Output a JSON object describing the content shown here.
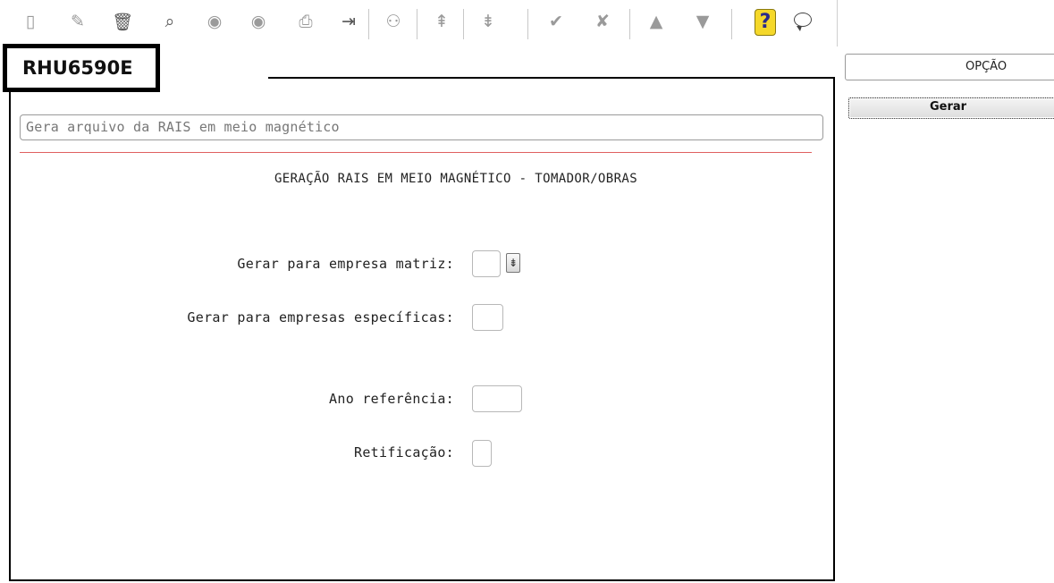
{
  "toolbar": {
    "buttons": [
      {
        "icon": "new-document-icon",
        "glyph": "▯"
      },
      {
        "icon": "edit-icon",
        "glyph": "✎"
      },
      {
        "icon": "trash-icon",
        "glyph": "🗑"
      },
      {
        "icon": "search-icon",
        "glyph": "⌕"
      },
      {
        "icon": "previous-icon",
        "glyph": "◉"
      },
      {
        "icon": "next-icon",
        "glyph": "◉"
      },
      {
        "icon": "print-icon",
        "glyph": "⎙"
      },
      {
        "icon": "exit-icon",
        "glyph": "⇥"
      },
      {
        "icon": "binoculars-icon",
        "glyph": "⚇"
      },
      {
        "icon": "first-record-icon",
        "glyph": "⇞"
      },
      {
        "icon": "last-record-icon",
        "glyph": "⇟"
      },
      {
        "icon": "confirm-icon",
        "glyph": "✔"
      },
      {
        "icon": "cancel-icon",
        "glyph": "✘"
      },
      {
        "icon": "up-icon",
        "glyph": "▲"
      },
      {
        "icon": "filter-icon",
        "glyph": "▼"
      }
    ],
    "help_glyph": "?"
  },
  "form": {
    "code": "RHU6590E",
    "description": "Gera arquivo da RAIS em meio magnético",
    "section_title": "GERAÇÃO RAIS EM MEIO MAGNÉTICO - TOMADOR/OBRAS",
    "fields": {
      "empresa_matriz_label": "Gerar para empresa matriz:",
      "empresa_matriz_value": "",
      "empresas_especificas_label": "Gerar para empresas específicas:",
      "empresas_especificas_value": "",
      "ano_referencia_label": "Ano referência:",
      "ano_referencia_value": "",
      "retificacao_label": "Retificação:",
      "retificacao_value": ""
    },
    "dropdown_glyph": "⇟"
  },
  "side_panel": {
    "header": "OPÇÃO",
    "options": [
      "Gerar"
    ]
  },
  "colors": {
    "separator_line": "#e06060",
    "help_icon": "#f5d82a"
  }
}
